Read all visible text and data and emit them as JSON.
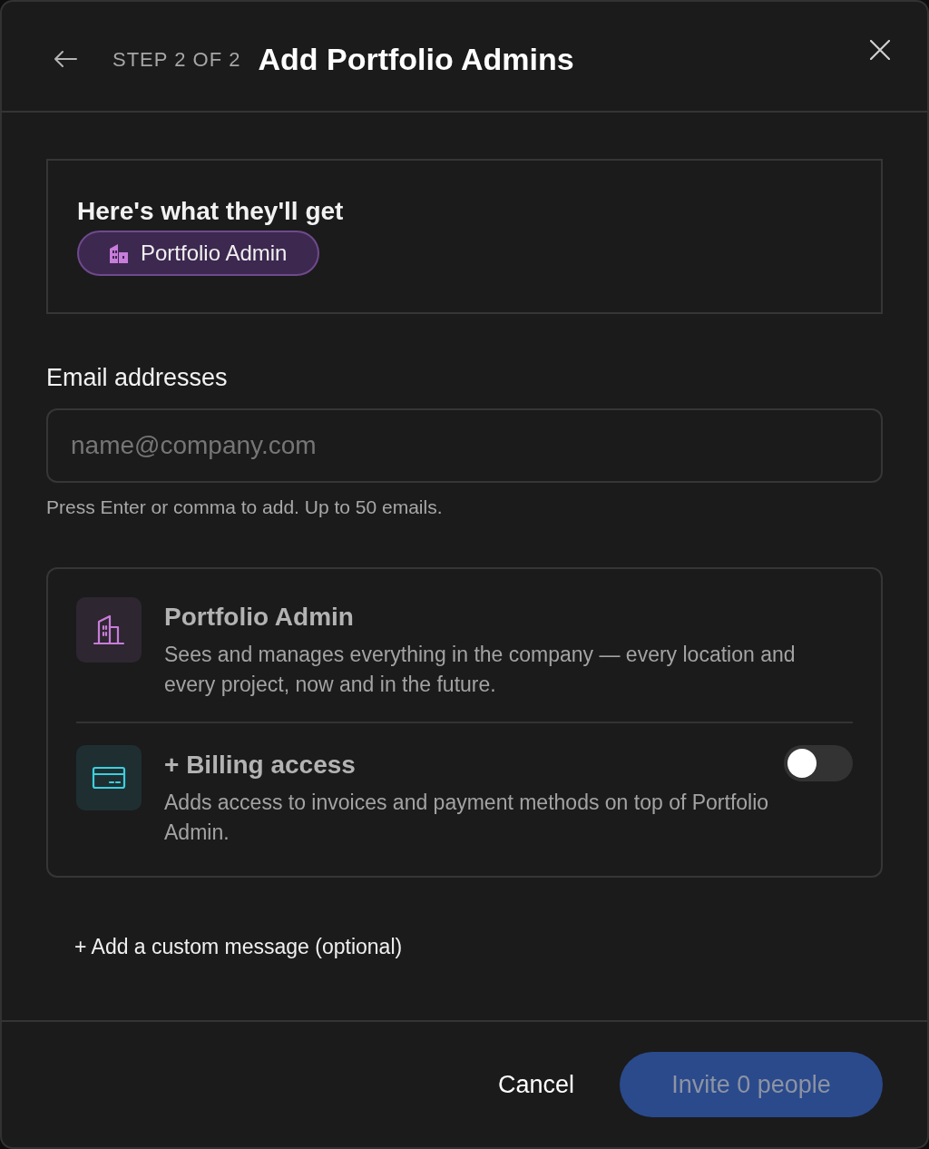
{
  "header": {
    "step": "STEP 2 OF 2",
    "title": "Add Portfolio Admins"
  },
  "summary": {
    "heading": "Here's what they'll get",
    "badges": [
      {
        "label": "Portfolio Admin"
      }
    ]
  },
  "email": {
    "label": "Email addresses",
    "placeholder": "name@company.com",
    "hint": "Press Enter or comma to add. Up to 50 emails."
  },
  "roles": [
    {
      "kind": "role",
      "title": "Portfolio Admin",
      "description": "Sees and manages everything in the company — every location and every project, now and in the future.",
      "color": "#c77dda"
    },
    {
      "kind": "addon",
      "title": "+ Billing access",
      "description": "Adds access to invoices and payment methods on top of Portfolio Admin.",
      "color": "#3ccfe0",
      "on": false
    }
  ],
  "custom_message": {
    "label": "+ Add a custom message (optional)"
  },
  "footer": {
    "cancel": "Cancel",
    "submit": {
      "label": "Invite 0 people",
      "disabled": true
    }
  }
}
